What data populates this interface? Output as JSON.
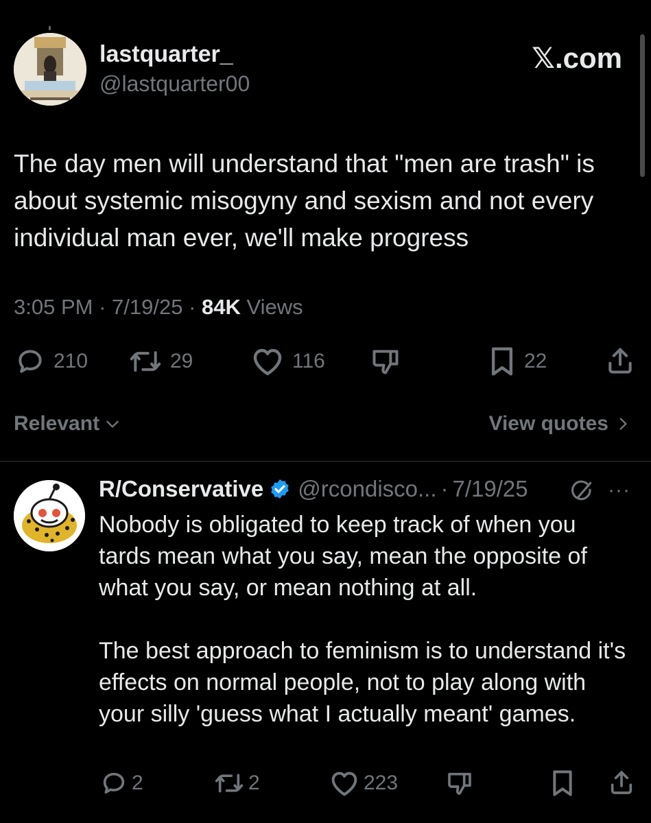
{
  "colors": {
    "background": "#000000",
    "text": "#e7e9ea",
    "muted": "#71767b",
    "verified": "#1d9bf0",
    "divider": "#2f3336"
  },
  "tweet": {
    "display_name": "lastquarter_",
    "handle": "@lastquarter00",
    "site_label": "𝕏.com",
    "text": "The day men will understand that \"men are trash\" is about systemic misogyny and sexism and not every individual man ever, we'll make progress",
    "time": "3:05 PM",
    "sep": "·",
    "date": "7/19/25",
    "views_count": "84K",
    "views_label": "Views",
    "actions": {
      "replies": {
        "icon": "reply-icon",
        "count": "210"
      },
      "reposts": {
        "icon": "repost-icon",
        "count": "29"
      },
      "likes": {
        "icon": "heart-icon",
        "count": "116"
      },
      "dislike": {
        "icon": "thumbs-down-icon"
      },
      "bookmarks": {
        "icon": "bookmark-icon",
        "count": "22"
      },
      "share": {
        "icon": "share-icon"
      }
    }
  },
  "filter": {
    "sort_label": "Relevant",
    "view_quotes_label": "View quotes"
  },
  "reply": {
    "display_name": "R/Conservative",
    "handle": "@rcondisco...",
    "sep": "·",
    "date": "7/19/25",
    "more": "···",
    "paragraphs": [
      "Nobody is obligated to keep track of when you tards mean what you say, mean the opposite of what you say, or mean nothing at all.",
      "The best approach to feminism is to understand it's effects on normal people, not to play along with your silly 'guess what I actually meant' games."
    ],
    "actions": {
      "replies": {
        "icon": "reply-icon",
        "count": "2"
      },
      "reposts": {
        "icon": "repost-icon",
        "count": "2"
      },
      "likes": {
        "icon": "heart-icon",
        "count": "223"
      },
      "dislike": {
        "icon": "thumbs-down-icon"
      },
      "bookmark": {
        "icon": "bookmark-icon"
      },
      "share": {
        "icon": "share-icon"
      }
    }
  }
}
